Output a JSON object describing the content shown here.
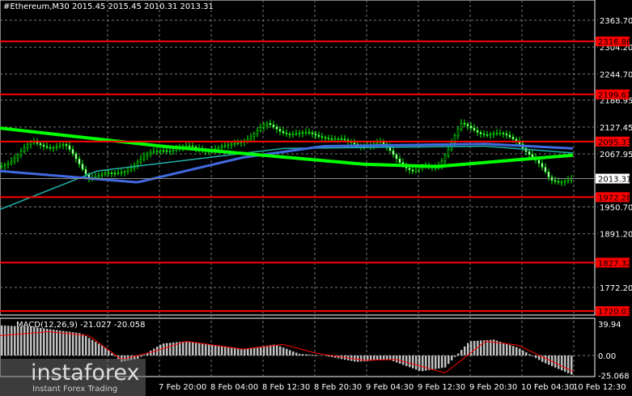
{
  "header": {
    "title": "#Ethereum,M30  2015.45 2015.45 2010.31 2013.31"
  },
  "price_axis": {
    "ticks": [
      "2363.70",
      "2304.20",
      "2244.70",
      "2186.95",
      "2127.45",
      "2067.95",
      "1950.70",
      "1891.20",
      "1772.20"
    ],
    "current": "2013.31"
  },
  "levels": [
    "2316.86",
    "2199.61",
    "2095.33",
    "1972.28",
    "1827.32",
    "1720.03"
  ],
  "time_axis": [
    "7 Feb 20:00",
    "8 Feb 04:00",
    "8 Feb 12:30",
    "8 Feb 20:30",
    "9 Feb 04:30",
    "9 Feb 12:30",
    "9 Feb 20:30",
    "10 Feb 04:30",
    "10 Feb 12:30"
  ],
  "macd": {
    "label": "MACD(12,26,9) -21.027 -20.058",
    "ticks": [
      "39.94",
      "0.00",
      "-25.068"
    ]
  },
  "watermark": {
    "brand": "instaforex",
    "tagline": "Instant Forex Trading"
  },
  "colors": {
    "level": "#ff0000",
    "bull": "#00ff00",
    "ma_slow": "#00ff00",
    "ma_mid": "#4169e1",
    "ma_fast": "#20b2aa"
  },
  "chart_data": {
    "type": "candlestick",
    "timeframe": "M30",
    "close_path": [
      [
        0,
        2040
      ],
      [
        40,
        2090
      ],
      [
        80,
        2085
      ],
      [
        110,
        2020
      ],
      [
        140,
        2020
      ],
      [
        170,
        2050
      ],
      [
        200,
        2080
      ],
      [
        240,
        2080
      ],
      [
        280,
        2080
      ],
      [
        330,
        2130
      ],
      [
        370,
        2110
      ],
      [
        400,
        2110
      ],
      [
        430,
        2090
      ],
      [
        470,
        2090
      ],
      [
        510,
        2030
      ],
      [
        540,
        2040
      ],
      [
        570,
        2130
      ],
      [
        600,
        2115
      ],
      [
        640,
        2100
      ],
      [
        660,
        2055
      ],
      [
        680,
        2010
      ],
      [
        708,
        2013
      ]
    ],
    "ma_slow": [
      [
        0,
        2125
      ],
      [
        200,
        2085
      ],
      [
        450,
        2045
      ],
      [
        540,
        2040
      ],
      [
        640,
        2055
      ],
      [
        708,
        2065
      ]
    ],
    "ma_mid": [
      [
        0,
        2030
      ],
      [
        170,
        2005
      ],
      [
        300,
        2060
      ],
      [
        400,
        2085
      ],
      [
        600,
        2090
      ],
      [
        708,
        2080
      ]
    ],
    "ma_fast": [
      [
        0,
        1945
      ],
      [
        120,
        2030
      ],
      [
        350,
        2080
      ],
      [
        600,
        2085
      ],
      [
        708,
        2070
      ]
    ],
    "macd_hist": [
      [
        0,
        38
      ],
      [
        40,
        36
      ],
      [
        100,
        28
      ],
      [
        130,
        10
      ],
      [
        150,
        -8
      ],
      [
        170,
        -4
      ],
      [
        200,
        15
      ],
      [
        230,
        18
      ],
      [
        270,
        12
      ],
      [
        300,
        8
      ],
      [
        340,
        14
      ],
      [
        370,
        2
      ],
      [
        400,
        0
      ],
      [
        440,
        -8
      ],
      [
        480,
        -5
      ],
      [
        520,
        -20
      ],
      [
        550,
        -15
      ],
      [
        580,
        18
      ],
      [
        610,
        20
      ],
      [
        640,
        10
      ],
      [
        670,
        -8
      ],
      [
        708,
        -25
      ]
    ],
    "macd_signal": [
      [
        0,
        25
      ],
      [
        60,
        30
      ],
      [
        110,
        25
      ],
      [
        150,
        -5
      ],
      [
        190,
        5
      ],
      [
        230,
        18
      ],
      [
        300,
        8
      ],
      [
        350,
        14
      ],
      [
        390,
        3
      ],
      [
        450,
        -6
      ],
      [
        490,
        -5
      ],
      [
        550,
        -22
      ],
      [
        600,
        18
      ],
      [
        640,
        13
      ],
      [
        708,
        -20
      ]
    ]
  }
}
